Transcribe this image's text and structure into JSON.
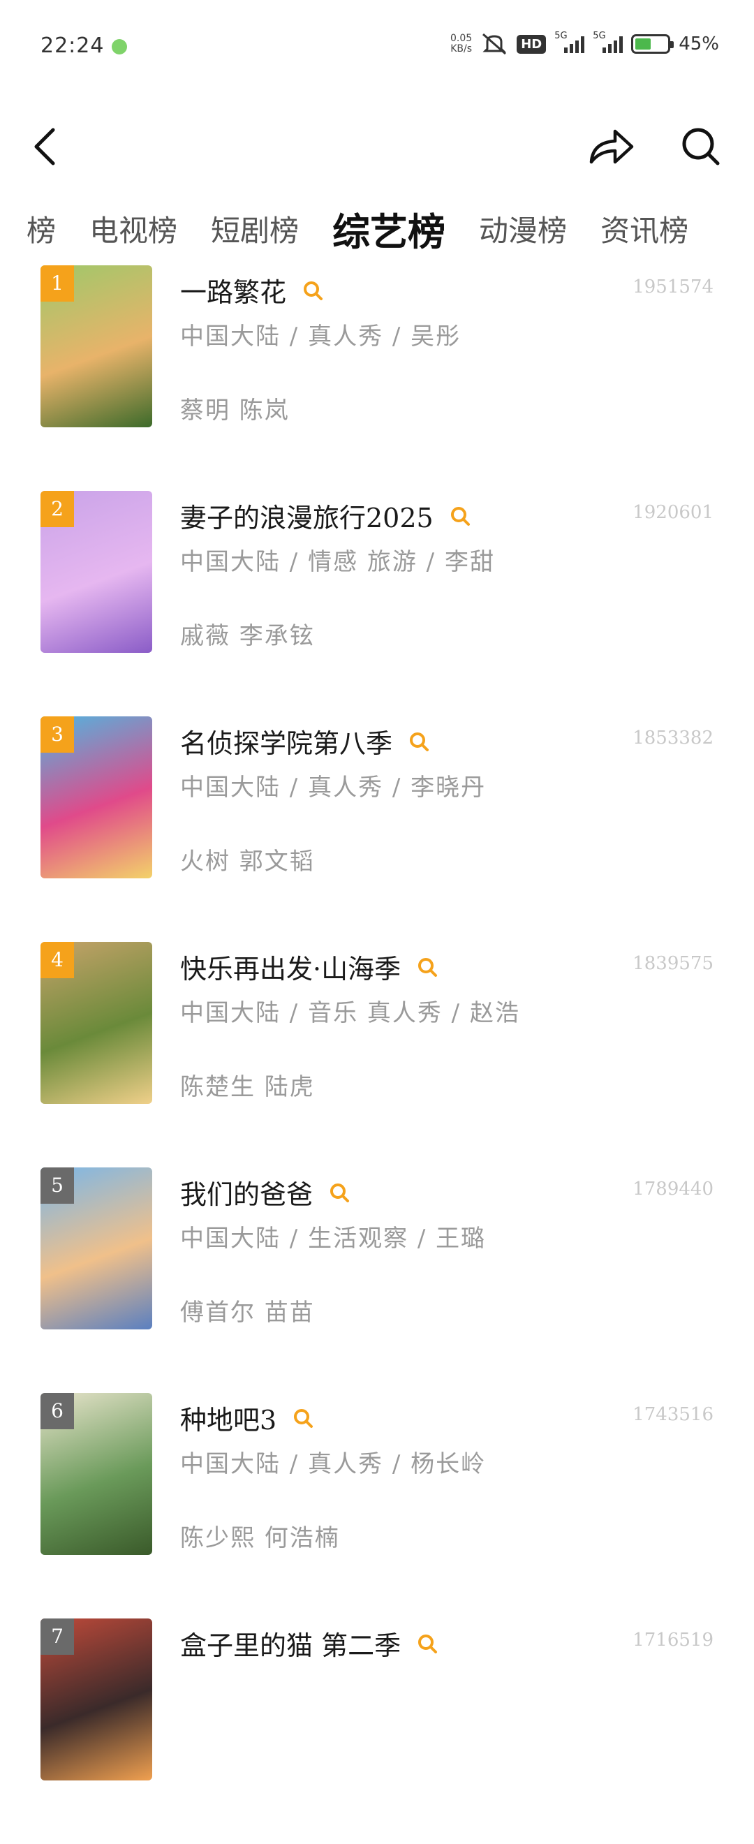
{
  "status_bar": {
    "time": "22:24",
    "network_speed_value": "0.05",
    "network_speed_unit": "KB/s",
    "hd_label": "HD",
    "signal_labels": [
      "5G",
      "5G"
    ],
    "battery": "45%"
  },
  "tabs": [
    {
      "label": "榜",
      "active": false
    },
    {
      "label": "电视榜",
      "active": false
    },
    {
      "label": "短剧榜",
      "active": false
    },
    {
      "label": "综艺榜",
      "active": true
    },
    {
      "label": "动漫榜",
      "active": false
    },
    {
      "label": "资讯榜",
      "active": false
    }
  ],
  "colors": {
    "accent": "#f5a21b",
    "rank_gray": "#6a6a6a",
    "meta_text": "#9a9a9a",
    "score_text": "#c8c8c8"
  },
  "items": [
    {
      "rank": "1",
      "title": "一路繁花",
      "score": "1951574",
      "meta": "中国大陆 / 真人秀 / 吴彤",
      "cast": "蔡明 陈岚",
      "poster_colors": [
        "#9ec86a",
        "#e8b36a",
        "#3c6a2a"
      ]
    },
    {
      "rank": "2",
      "title": "妻子的浪漫旅行2025",
      "score": "1920601",
      "meta": "中国大陆 / 情感 旅游 / 李甜",
      "cast": "戚薇 李承铉",
      "poster_colors": [
        "#c9a3e8",
        "#e6b7f0",
        "#8a5cc7"
      ]
    },
    {
      "rank": "3",
      "title": "名侦探学院第八季",
      "score": "1853382",
      "meta": "中国大陆 / 真人秀 / 李晓丹",
      "cast": "火树 郭文韬",
      "poster_colors": [
        "#4fb6e0",
        "#e04a8a",
        "#f3d26a"
      ]
    },
    {
      "rank": "4",
      "title": "快乐再出发·山海季",
      "score": "1839575",
      "meta": "中国大陆 / 音乐 真人秀 / 赵浩",
      "cast": "陈楚生 陆虎",
      "poster_colors": [
        "#c7a36a",
        "#6a8a3a",
        "#f0d08a"
      ]
    },
    {
      "rank": "5",
      "title": "我们的爸爸",
      "score": "1789440",
      "meta": "中国大陆 / 生活观察 / 王璐",
      "cast": "傅首尔 苗苗",
      "poster_colors": [
        "#7ab6e8",
        "#f0c08a",
        "#5a7fc0"
      ]
    },
    {
      "rank": "6",
      "title": "种地吧3",
      "score": "1743516",
      "meta": "中国大陆 / 真人秀 / 杨长岭",
      "cast": "陈少熙 何浩楠",
      "poster_colors": [
        "#e8e4cc",
        "#6a9a5a",
        "#3a5a2a"
      ]
    },
    {
      "rank": "7",
      "title": "盒子里的猫 第二季",
      "score": "1716519",
      "meta": "",
      "cast": "",
      "poster_colors": [
        "#c04a3a",
        "#3a2a2a",
        "#f0a050"
      ]
    }
  ]
}
